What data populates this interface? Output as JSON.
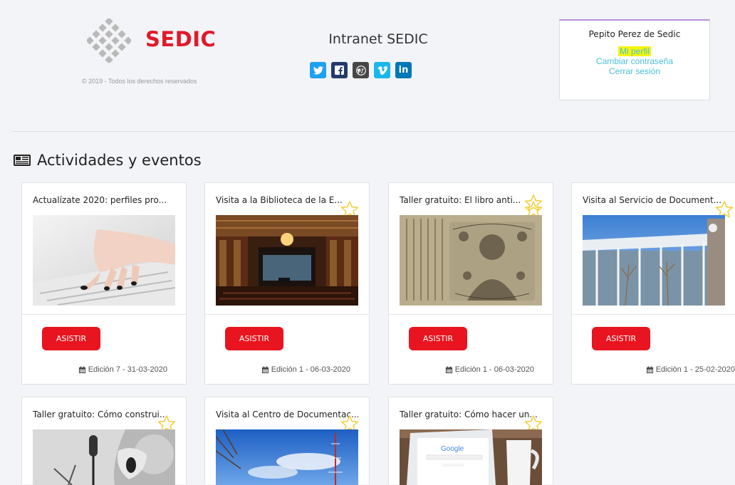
{
  "header": {
    "logo_text": "SEDIC",
    "copyright": "© 2019 - Todos los derechos reservados",
    "site_title": "Intranet SEDIC",
    "socials": [
      {
        "icon": "twitter-icon",
        "color": "#1da1f2"
      },
      {
        "icon": "facebook-icon",
        "color": "#3b5998"
      },
      {
        "icon": "wordpress-icon",
        "color": "#464646"
      },
      {
        "icon": "vimeo-icon",
        "color": "#1ab7ea"
      },
      {
        "icon": "linkedin-icon",
        "color": "#0077b5"
      }
    ]
  },
  "user": {
    "name": "Pepito Perez de Sedic",
    "profile": "Mi perfil",
    "change_password": "Cambiar contraseña",
    "logout": "Cerrar sesión"
  },
  "section": {
    "title": "Actividades y eventos",
    "icon": "newspaper-icon"
  },
  "cards": [
    {
      "title": "Actualízate 2020: perfiles pro...",
      "button": "ASISTIR",
      "edition": "Edición 7 - 31-03-2020",
      "image": "typing-hands",
      "favorite_icon": "star-icon"
    },
    {
      "title": "Visita a la Biblioteca de la E...",
      "button": "ASISTIR",
      "edition": "Edición 1 - 06-03-2020",
      "image": "concert-hall",
      "favorite_icon": "star-icon"
    },
    {
      "title": "Taller gratuito: El libro anti...",
      "button": "ASISTIR",
      "edition": "Edición 1 - 06-03-2020",
      "image": "ancient-manuscript",
      "favorite_icon": "star-icon"
    },
    {
      "title": "Visita al Servicio de Document...",
      "button": "ASISTIR",
      "edition": "Edición 1 - 25-02-2020",
      "image": "modern-building",
      "favorite_icon": "star-icon"
    },
    {
      "title": "Taller gratuito: Cómo construi...",
      "button": "",
      "edition": "",
      "image": "podcast-microphone",
      "favorite_icon": "star-icon"
    },
    {
      "title": "Visita al Centro de Documentac...",
      "button": "",
      "edition": "",
      "image": "sky-antenna",
      "favorite_icon": "star-icon"
    },
    {
      "title": "Taller gratuito: Cómo hacer un...",
      "button": "",
      "edition": "",
      "image": "laptop-google",
      "image_text": "Google",
      "favorite_icon": "star-icon"
    }
  ],
  "colors": {
    "brand_red": "#e01a2b",
    "button_red": "#e8141f",
    "link": "#4bc0d9",
    "highlight": "#f5f50b",
    "star": "#f4d03f"
  }
}
